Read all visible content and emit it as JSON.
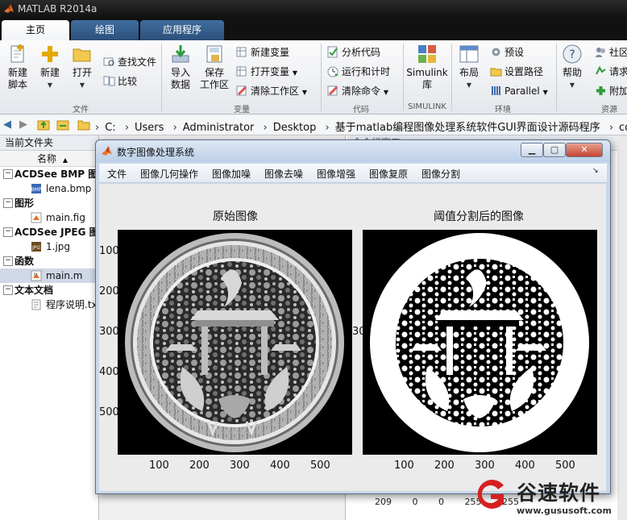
{
  "app": {
    "title": "MATLAB R2014a"
  },
  "tabs": [
    {
      "label": "主页",
      "active": true
    },
    {
      "label": "绘图",
      "active": false
    },
    {
      "label": "应用程序",
      "active": false
    }
  ],
  "ribbon": {
    "file": {
      "section": "文件",
      "new_script": "新建\n脚本",
      "new": "新建",
      "open": "打开",
      "find_files": "查找文件",
      "compare": "比较"
    },
    "variable": {
      "section": "变量",
      "import": "导入\n数据",
      "save_workspace": "保存\n工作区",
      "new_variable": "新建变量",
      "open_variable": "打开变量",
      "clear_workspace": "清除工作区"
    },
    "code": {
      "section": "代码",
      "analyze": "分析代码",
      "run_time": "运行和计时",
      "clear_commands": "清除命令"
    },
    "simulink": {
      "section": "SIMULINK",
      "library": "Simulink\n库"
    },
    "environment": {
      "section": "环境",
      "layout": "布局",
      "preferences": "预设",
      "set_path": "设置路径",
      "parallel": "Parallel"
    },
    "resources": {
      "section": "资源",
      "help": "帮助",
      "community": "社区",
      "request": "请求",
      "addons": "附加"
    }
  },
  "address": {
    "crumbs": [
      "C:",
      "Users",
      "Administrator",
      "Desktop",
      "基于matlab编程图像处理系统软件GUI界面设计源码程序",
      "code"
    ]
  },
  "current_folder": {
    "title": "当前文件夹",
    "column": "名称",
    "groups": [
      {
        "name": "ACDSee BMP 图像",
        "files": [
          {
            "name": "lena.bmp",
            "icon": "bmp-icon"
          }
        ]
      },
      {
        "name": "图形",
        "files": [
          {
            "name": "main.fig",
            "icon": "fig-icon"
          }
        ]
      },
      {
        "name": "ACDSee JPEG 图像",
        "files": [
          {
            "name": "1.jpg",
            "icon": "jpg-icon"
          }
        ]
      },
      {
        "name": "函数",
        "files": [
          {
            "name": "main.m",
            "icon": "m-file-icon",
            "selected": true
          }
        ]
      },
      {
        "name": "文本文档",
        "files": [
          {
            "name": "程序说明.txt",
            "icon": "txt-icon"
          }
        ]
      }
    ]
  },
  "command_window": {
    "title": "命令行窗口",
    "values": [
      "209",
      "0",
      "0",
      "255",
      "255"
    ]
  },
  "figure": {
    "title": "数字图像处理系统",
    "menus": [
      "文件",
      "图像几何操作",
      "图像加噪",
      "图像去噪",
      "图像增强",
      "图像复原",
      "图像分割"
    ],
    "left_axis": {
      "title": "原始图像",
      "xticks": [
        "100",
        "200",
        "300",
        "400",
        "500"
      ],
      "yticks": [
        "100",
        "200",
        "300",
        "400",
        "500"
      ]
    },
    "right_axis": {
      "title": "阈值分割后的图像",
      "xticks": [
        "100",
        "200",
        "300",
        "400",
        "500"
      ],
      "yticks_partial": [
        "300"
      ]
    }
  },
  "watermark": {
    "brand": "谷速软件",
    "url": "www.gususoft.com",
    "color": "#d62020"
  }
}
